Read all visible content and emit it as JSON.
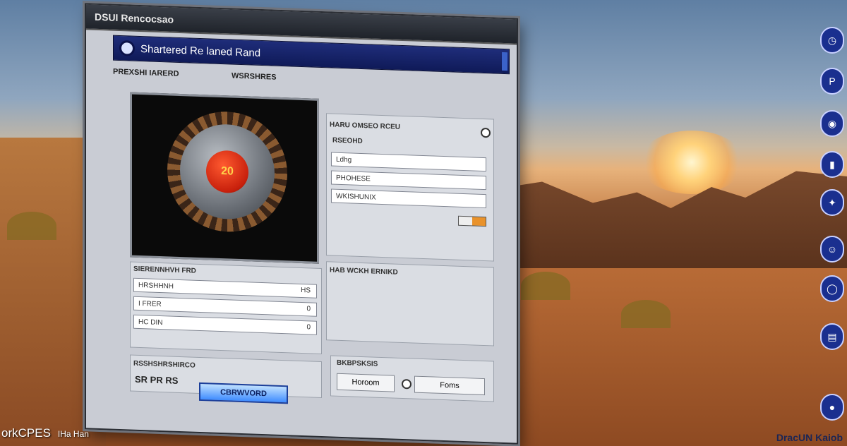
{
  "window": {
    "outer_title": "DSUI Rencocsao",
    "inner_title": "Shartered Re laned Rand",
    "tabs": [
      "PREXSHI IARERD",
      "WSRSHRES"
    ],
    "preview": {
      "knob_label": "20"
    },
    "right_panel": {
      "header": "HARU OMSEO RCEU",
      "group_label": "RSEOHD",
      "field_1": "Ldhg",
      "rows": [
        "PHOHESE",
        "WKISHUNIX"
      ],
      "section_title": "HAB WCKH ERNIKD"
    },
    "left_panel": {
      "header": "SIERENNHVH FRD",
      "rows": [
        {
          "label": "HRSHHNH",
          "suffix": "HS"
        },
        {
          "label": "I FRER",
          "suffix": "0"
        },
        {
          "label": "HC DIN",
          "suffix": "0"
        }
      ]
    },
    "bottom_left": {
      "label": "RSSHSHRSHIRCO",
      "value": "SR PR RS"
    },
    "bottom_right": {
      "label": "BKBPSKSIS",
      "button": "Horoom",
      "option": "Foms"
    },
    "primary_button": "CBRWVORD"
  },
  "taskbar": {
    "icons": [
      "clock-icon",
      "P-icon",
      "eye-icon",
      "page-icon",
      "shield-icon",
      "face-icon",
      "circle-icon",
      "chart-icon",
      "round-icon"
    ]
  },
  "watermarks": {
    "left": "orkCPES",
    "left_sub": "IHa Han",
    "right": "DracUN Kaiob"
  }
}
